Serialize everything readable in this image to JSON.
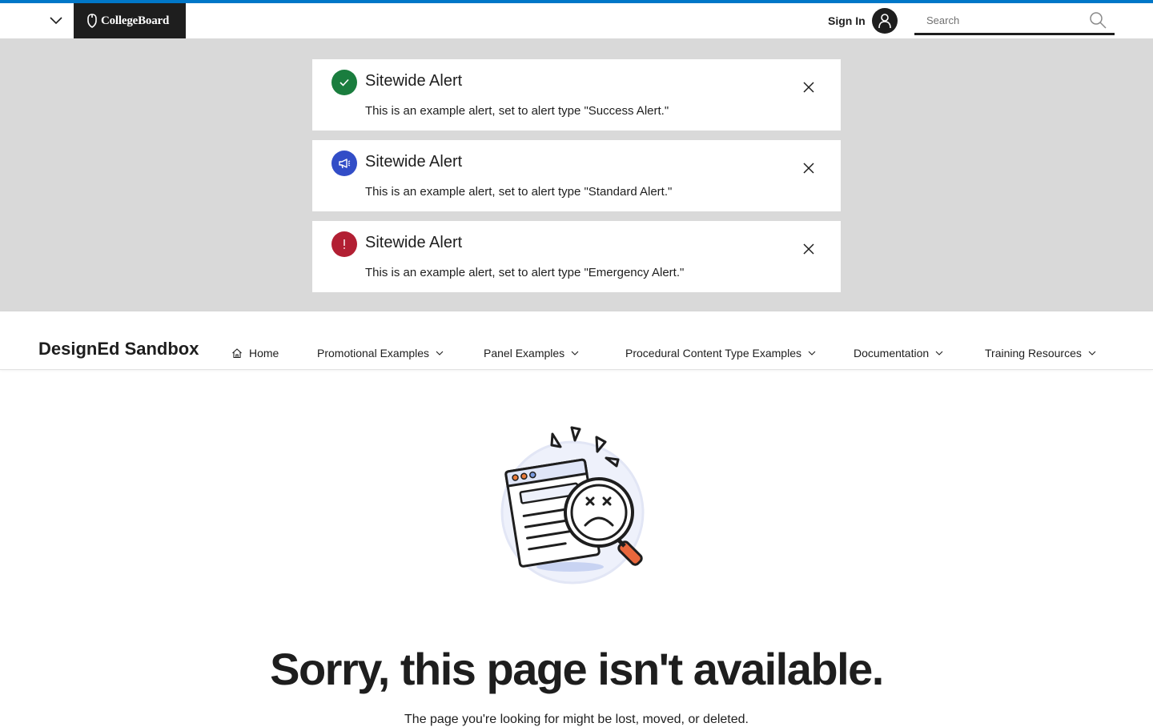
{
  "global_header": {
    "brand_name": "CollegeBoard",
    "sign_in_label": "Sign In",
    "search_placeholder": "Search"
  },
  "alerts": [
    {
      "type": "success",
      "title": "Sitewide Alert",
      "message": "This is an example alert, set to alert type \"Success Alert.\"",
      "color": "#1a7d3e"
    },
    {
      "type": "standard",
      "title": "Sitewide Alert",
      "message": "This is an example alert, set to alert type \"Standard Alert.\"",
      "color": "#324dc7"
    },
    {
      "type": "emergency",
      "title": "Sitewide Alert",
      "message": "This is an example alert, set to alert type \"Emergency Alert.\"",
      "color": "#c8102e"
    }
  ],
  "local_nav": {
    "site_title": "DesignEd Sandbox",
    "items": [
      {
        "label": "Home"
      },
      {
        "label": "Promotional Examples"
      },
      {
        "label": "Panel Examples"
      },
      {
        "label": "Procedural Content Type Examples"
      },
      {
        "label": "Documentation"
      },
      {
        "label": "Training Resources"
      }
    ]
  },
  "main": {
    "heading": "Sorry, this page isn't available.",
    "subtext": "The page you're looking for might be lost, moved, or deleted."
  },
  "colors": {
    "accent_stripe": "#0077c8",
    "alert_band": "#d9d9d9",
    "text": "#1e1e1e"
  }
}
